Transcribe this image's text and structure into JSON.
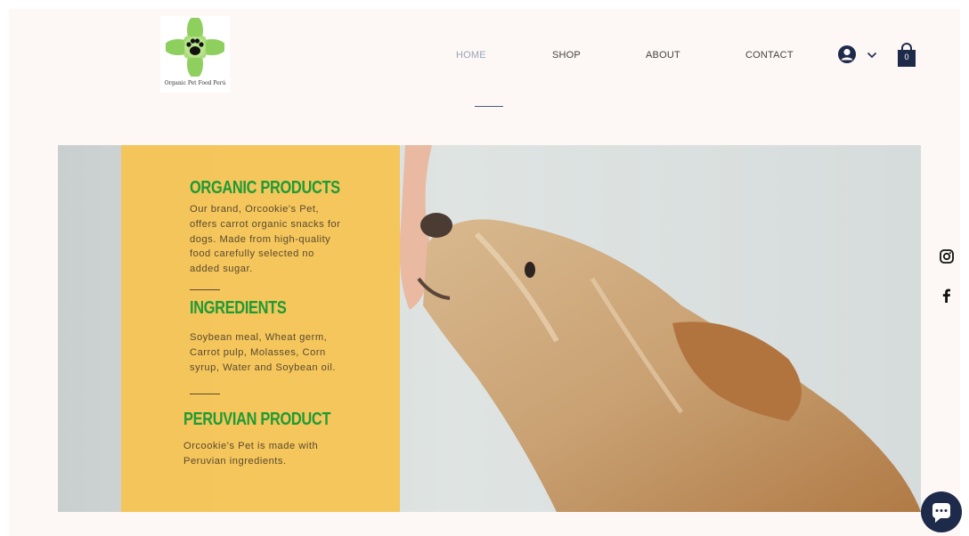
{
  "brand": {
    "logo_text": "Organic Pet Food Perú"
  },
  "nav": {
    "items": [
      {
        "label": "HOME",
        "active": true
      },
      {
        "label": "SHOP",
        "active": false
      },
      {
        "label": "ABOUT",
        "active": false
      },
      {
        "label": "CONTACT",
        "active": false
      }
    ]
  },
  "header": {
    "account_icon": "user-avatar-icon",
    "cart_icon": "shopping-bag-icon",
    "cart_count": "0"
  },
  "hero": {
    "sections": [
      {
        "title": "ORGANIC PRODUCTS",
        "lines": [
          "Our brand, Orcookie's Pet,",
          "offers carrot organic snacks for",
          "dogs. Made from high-quality",
          "food carefully selected no",
          "added sugar."
        ]
      },
      {
        "title": "INGREDIENTS",
        "lines": [
          "Soybean meal, Wheat germ,",
          "Carrot pulp, Molasses, Corn",
          "syrup, Water and Soybean oil."
        ]
      },
      {
        "title": "PERUVIAN PRODUCT",
        "lines": [
          "Orcookie's Pet is made with",
          "Peruvian ingredients."
        ]
      }
    ]
  },
  "social": {
    "instagram_icon": "instagram-icon",
    "facebook_icon": "facebook-icon"
  },
  "chat": {
    "icon": "chat-bubble-icon"
  },
  "colors": {
    "page_bg": "#fdf8f5",
    "panel": "#f6c452",
    "heading_green": "#1f9a35",
    "nav_active": "#9aa4b8",
    "accent_navy": "#1e2a4a"
  }
}
